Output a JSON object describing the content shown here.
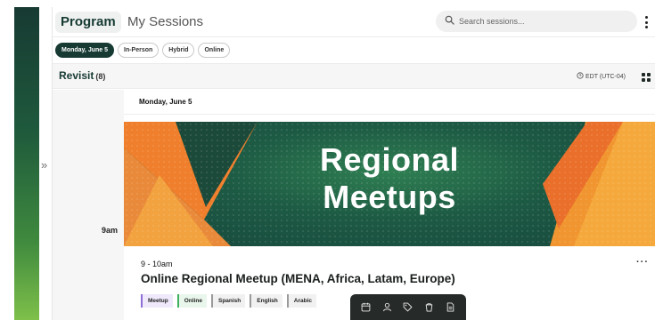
{
  "header": {
    "tabs": [
      {
        "label": "Program",
        "active": true
      },
      {
        "label": "My Sessions",
        "active": false
      }
    ],
    "search": {
      "placeholder": "Search sessions...",
      "value": ""
    }
  },
  "filters": [
    {
      "label": "Monday, June 5",
      "active": true
    },
    {
      "label": "In-Person",
      "active": false
    },
    {
      "label": "Hybrid",
      "active": false
    },
    {
      "label": "Online",
      "active": false
    }
  ],
  "revisit": {
    "title": "Revisit",
    "count": "(8)"
  },
  "timezone": "EDT (UTC-04)",
  "schedule": {
    "day_heading": "Monday, June 5",
    "time_slot": "9am"
  },
  "banner": {
    "line1": "Regional",
    "line2": "Meetups"
  },
  "session": {
    "time": "9 - 10am",
    "title": "Online Regional Meetup (MENA, Africa, Latam, Europe)",
    "tags": [
      "Meetup",
      "Online",
      "Spanish",
      "English",
      "Arabic"
    ]
  },
  "toolbar": {
    "icons": [
      "calendar-icon",
      "person-icon",
      "tag-icon",
      "cup-icon",
      "document-icon"
    ]
  },
  "colors": {
    "brand_dark": "#173a33",
    "brand_green": "#2f7f52",
    "accent_orange": "#f08a2e",
    "tag_meetup": "#8e6fd6",
    "tag_online": "#3cb05a"
  }
}
